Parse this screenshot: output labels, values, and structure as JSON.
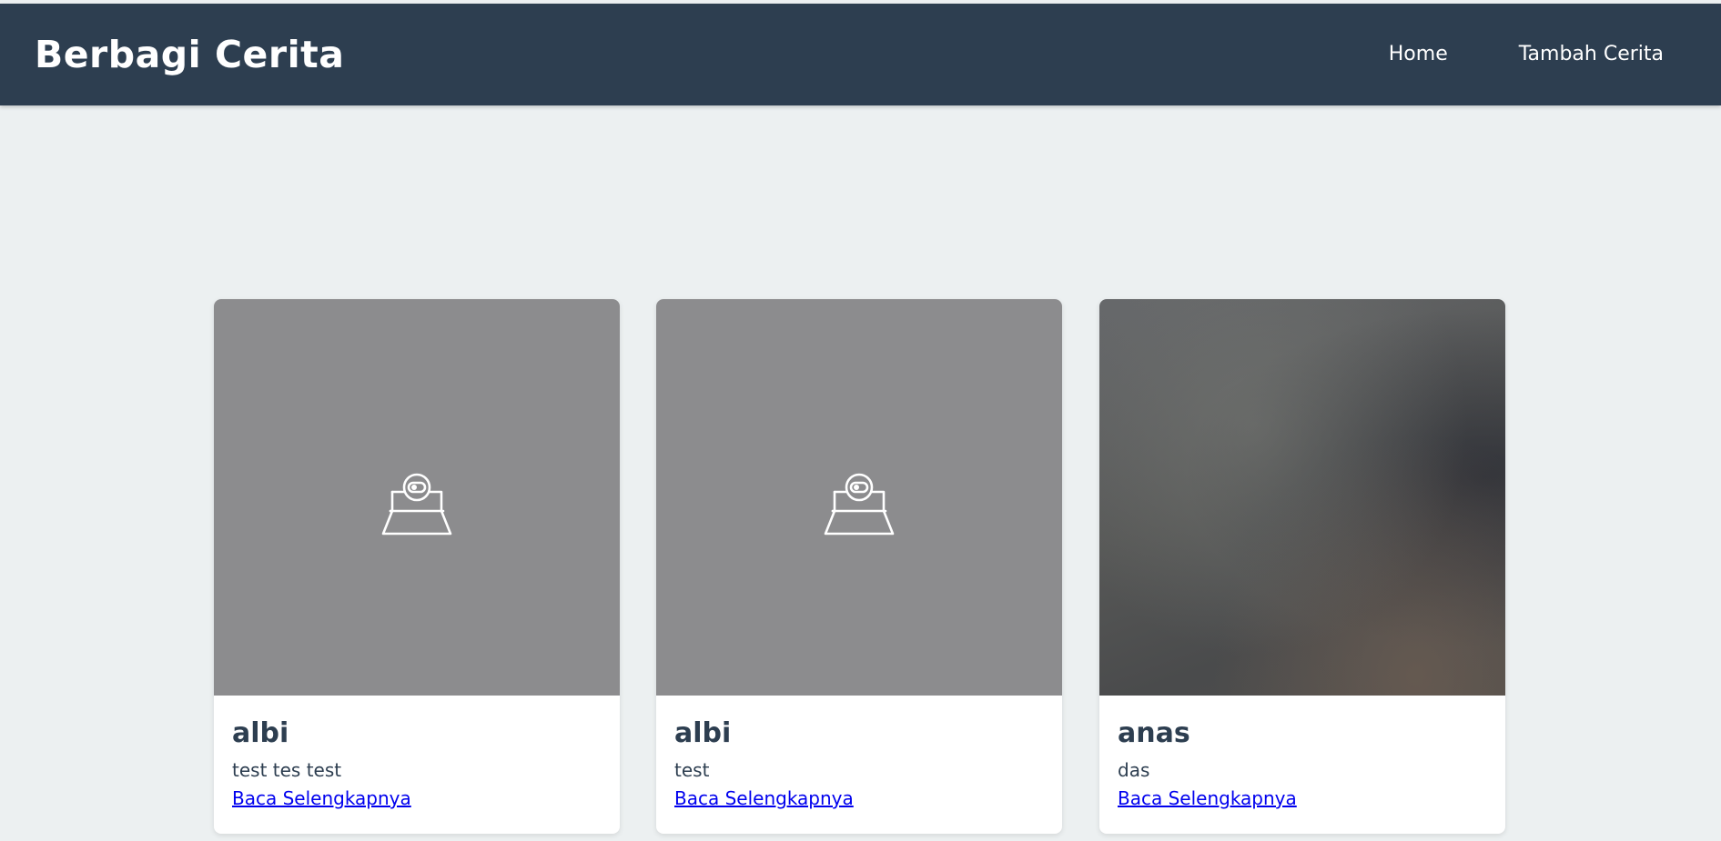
{
  "header": {
    "brand": "Berbagi Cerita",
    "nav": [
      {
        "label": "Home"
      },
      {
        "label": "Tambah Cerita"
      }
    ]
  },
  "colors": {
    "header_bg": "#2d3e50",
    "page_bg": "#ecf0f1",
    "placeholder_bg": "#8c8c8e",
    "link": "#0000ee"
  },
  "stories": [
    {
      "name": "albi",
      "description": "test tes test",
      "link_label": "Baca Selengkapnya",
      "image": "camera-placeholder-icon"
    },
    {
      "name": "albi",
      "description": "test",
      "link_label": "Baca Selengkapnya",
      "image": "camera-placeholder-icon"
    },
    {
      "name": "anas",
      "description": "das",
      "link_label": "Baca Selengkapnya",
      "image": "photo"
    }
  ]
}
